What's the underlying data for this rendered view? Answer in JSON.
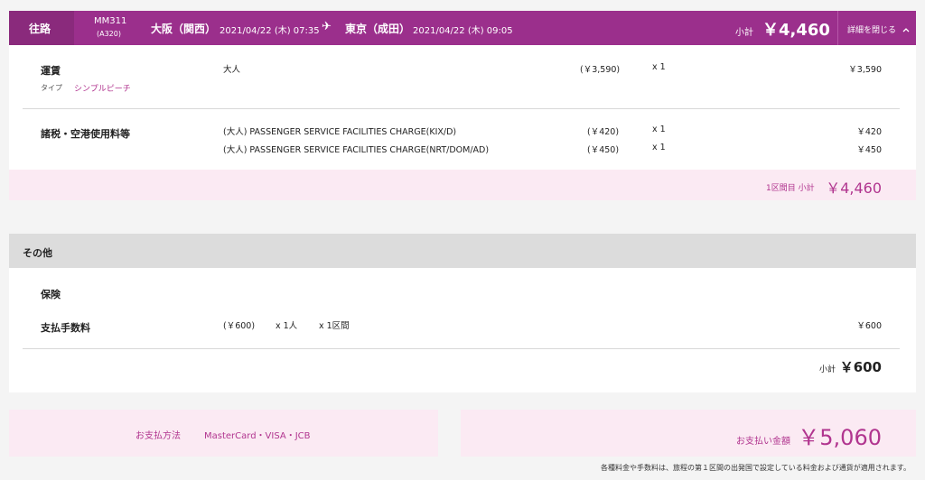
{
  "header": {
    "tab_label": "往路",
    "flight_no": "MM311",
    "aircraft": "(A320)",
    "origin": "大阪（関西）",
    "depart_time": "2021/04/22 (木) 07:35",
    "plane_glyph": "✈",
    "destination": "東京（成田）",
    "arrive_time": "2021/04/22 (木) 09:05",
    "subtotal_label": "小計",
    "subtotal_value": "￥4,460",
    "toggle_label": "詳細を閉じる",
    "toggle_icon": "chevron-up-icon"
  },
  "fare": {
    "label": "運賃",
    "type_label": "タイプ",
    "type_value": "シンプルピーチ",
    "pax": "大人",
    "unit": "(￥3,590)",
    "qty": "x 1",
    "amount": "￥3,590"
  },
  "taxes": {
    "label": "諸税・空港使用料等",
    "rows": [
      {
        "desc": "(大人) PASSENGER SERVICE FACILITIES CHARGE(KIX/D)",
        "unit": "(￥420)",
        "qty": "x 1",
        "amount": "￥420"
      },
      {
        "desc": "(大人) PASSENGER SERVICE FACILITIES CHARGE(NRT/DOM/AD)",
        "unit": "(￥450)",
        "qty": "x 1",
        "amount": "￥450"
      }
    ]
  },
  "segment_subtotal": {
    "label": "1区間目 小計",
    "value": "￥4,460"
  },
  "other": {
    "title": "その他",
    "insurance_label": "保険",
    "fee_label": "支払手数料",
    "fee_unit": "(￥600)",
    "fee_pax": "x 1人",
    "fee_segments": "x 1区間",
    "fee_amount": "￥600",
    "subtotal_label": "小計",
    "subtotal_value": "￥600"
  },
  "payment": {
    "method_label": "お支払方法",
    "method_value": "MasterCard・VISA・JCB",
    "total_label": "お支払い金額",
    "total_value": "￥5,060"
  },
  "footnote": "各種料金や手数料は、旅程の第１区間の出発国で設定している料金および通貨が適用されます。",
  "colors": {
    "accent": "#9b2f8c",
    "accent_text": "#b1358f",
    "pink_bg": "#fbeaf3",
    "section_gray": "#dcdcdc"
  }
}
